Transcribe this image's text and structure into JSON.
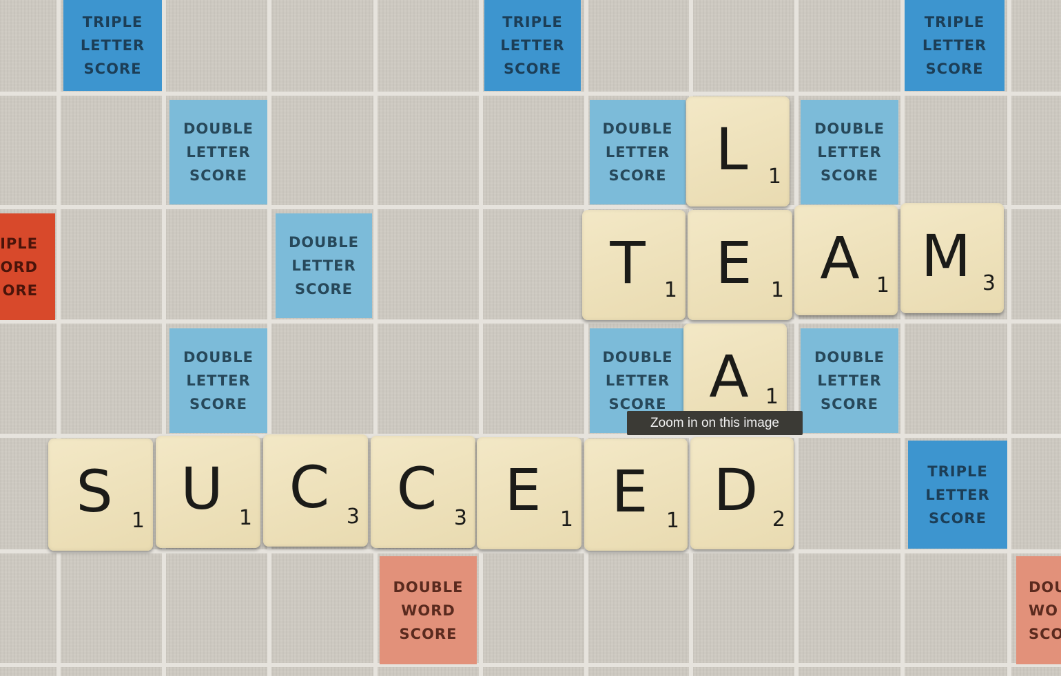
{
  "image": {
    "premium_squares": [
      {
        "type": "triple-letter",
        "lines": [
          "TRIPLE",
          "LETTER",
          "SCORE"
        ]
      },
      {
        "type": "triple-letter",
        "lines": [
          "TRIPLE",
          "LETTER",
          "SCORE"
        ]
      },
      {
        "type": "triple-letter",
        "lines": [
          "TRIPLE",
          "LETTER",
          "SCORE"
        ]
      },
      {
        "type": "double-letter",
        "lines": [
          "DOUBLE",
          "LETTER",
          "SCORE"
        ]
      },
      {
        "type": "double-letter",
        "lines": [
          "DOUBLE",
          "LETTER",
          "SCORE"
        ]
      },
      {
        "type": "double-letter",
        "lines": [
          "DOUBLE",
          "LETTER",
          "SCORE"
        ]
      },
      {
        "type": "triple-word",
        "lines": [
          "IPLE",
          "ORD",
          "ORE"
        ]
      },
      {
        "type": "double-letter",
        "lines": [
          "DOUBLE",
          "LETTER",
          "SCORE"
        ]
      },
      {
        "type": "double-letter",
        "lines": [
          "DOUBLE",
          "LETTER",
          "SCORE"
        ]
      },
      {
        "type": "double-letter",
        "lines": [
          "DOUBLE",
          "LETTER",
          "SCORE"
        ]
      },
      {
        "type": "double-letter",
        "lines": [
          "DOUBLE",
          "LETTER",
          "SCORE"
        ]
      },
      {
        "type": "triple-letter",
        "lines": [
          "TRIPLE",
          "LETTER",
          "SCORE"
        ]
      },
      {
        "type": "double-word",
        "lines": [
          "DOUBLE",
          "WORD",
          "SCORE"
        ]
      },
      {
        "type": "double-word",
        "lines": [
          "DOU",
          "WO",
          "SCO"
        ]
      }
    ],
    "tiles": [
      {
        "letter": "L",
        "value": "1"
      },
      {
        "letter": "T",
        "value": "1"
      },
      {
        "letter": "E",
        "value": "1"
      },
      {
        "letter": "A",
        "value": "1"
      },
      {
        "letter": "M",
        "value": "3"
      },
      {
        "letter": "A",
        "value": "1"
      },
      {
        "letter": "S",
        "value": "1"
      },
      {
        "letter": "U",
        "value": "1"
      },
      {
        "letter": "C",
        "value": "3"
      },
      {
        "letter": "C",
        "value": "3"
      },
      {
        "letter": "E",
        "value": "1"
      },
      {
        "letter": "E",
        "value": "1"
      },
      {
        "letter": "D",
        "value": "2"
      }
    ]
  },
  "tooltip": {
    "text": "Zoom in on this image"
  }
}
